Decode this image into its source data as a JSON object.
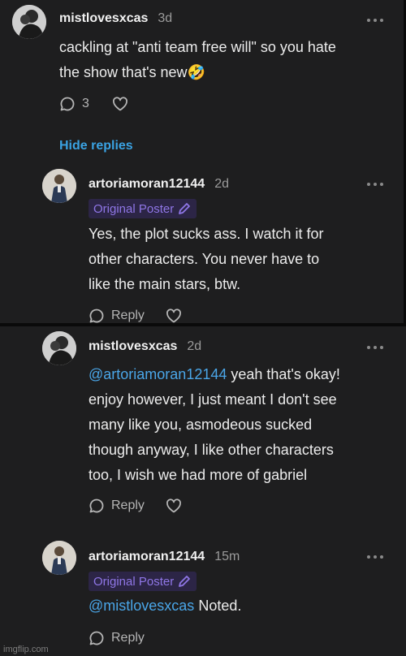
{
  "comments": [
    {
      "username": "mistlovesxcas",
      "time": "3d",
      "text_lines": [
        "cackling at \"anti team free will\" so you hate",
        "the show that's new🤣"
      ],
      "reply_count": "3"
    },
    {
      "username": "artoriamoran12144",
      "time": "2d",
      "badge": "Original Poster",
      "text_lines": [
        "Yes, the plot sucks ass. I watch it for",
        "other characters. You never have to",
        "like the main stars, btw."
      ],
      "reply_label": "Reply"
    },
    {
      "username": "mistlovesxcas",
      "time": "2d",
      "mention": "@artoriamoran12144",
      "first_line_rest": " yeah that's okay!",
      "text_lines": [
        "enjoy however, I just meant I don't see",
        "many like you, asmodeous sucked",
        "though anyway, I like other characters",
        "too, I wish we had more of gabriel"
      ],
      "reply_label": "Reply"
    },
    {
      "username": "artoriamoran12144",
      "time": "15m",
      "badge": "Original Poster",
      "mention": "@mistlovesxcas",
      "first_line_rest": " Noted.",
      "reply_label": "Reply"
    }
  ],
  "hide_replies_label": "Hide replies",
  "watermark": "imgflip.com",
  "colors": {
    "background": "#1e1e1f",
    "mention": "#4aa6e8",
    "badge_text": "#8f76e6",
    "badge_bg": "#2c2546",
    "link": "#3aa2e2"
  }
}
